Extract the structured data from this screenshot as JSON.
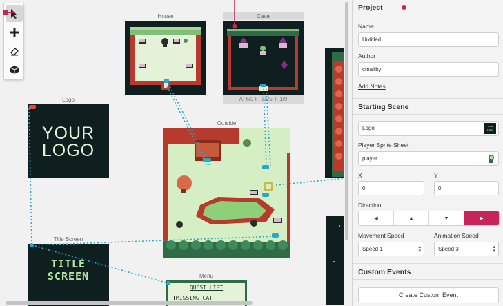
{
  "scenes": {
    "house": {
      "name": "House"
    },
    "cave": {
      "name": "Cave",
      "stats": "A: 6/9   F: 8/25   T: 1/9"
    },
    "logo": {
      "name": "Logo",
      "line1": "YOUR",
      "line2": "LOGO"
    },
    "outside": {
      "name": "Outside"
    },
    "title_screen": {
      "name": "Title Screen",
      "line1": "TITLE",
      "line2": "SCREEN"
    },
    "menu": {
      "name": "Menu",
      "line1": "QUEST LIST",
      "line2": "MISSING CAT"
    }
  },
  "toolbar": {
    "tools": [
      {
        "icon": "cursor-icon",
        "active": true
      },
      {
        "icon": "plus-icon",
        "active": false
      },
      {
        "icon": "eraser-icon",
        "active": false
      },
      {
        "icon": "cube-icon",
        "active": false
      }
    ]
  },
  "sidebar": {
    "project": {
      "header": "Project",
      "name_label": "Name",
      "name_value": "Untitled",
      "author_label": "Author",
      "author_value": "cmaltby",
      "notes_link": "Add Notes"
    },
    "starting_scene": {
      "header": "Starting Scene",
      "scene_value": "Logo",
      "scene_thumb": "YOUR LOGO",
      "sprite_label": "Player Sprite Sheet",
      "sprite_value": "player",
      "x_label": "X",
      "x_value": "0",
      "y_label": "Y",
      "y_value": "0",
      "direction_label": "Direction",
      "directions": [
        "◀",
        "▲",
        "▼",
        "▶"
      ],
      "active_direction": 3,
      "movement_label": "Movement Speed",
      "movement_value": "Speed 1",
      "animation_label": "Animation Speed",
      "animation_value": "Speed 3"
    },
    "custom_events": {
      "header": "Custom Events",
      "create_button": "Create Custom Event"
    }
  },
  "colors": {
    "accent": "#c6245b",
    "link_line": "#2aa8c6",
    "dark_bg": "#0f1f1f",
    "grass": "#d6eec4",
    "brick": "#b83a2c",
    "hedge": "#2f6b46"
  }
}
